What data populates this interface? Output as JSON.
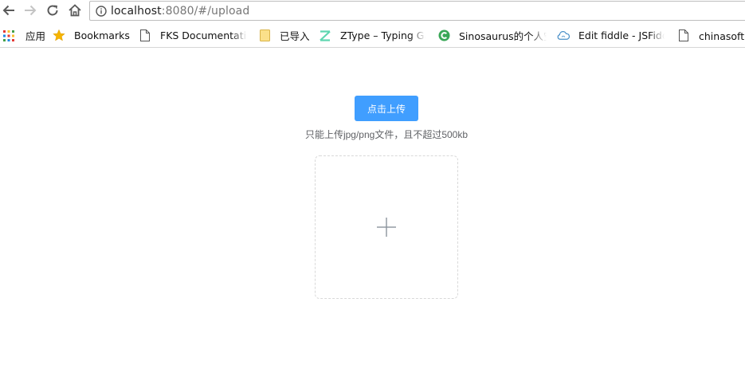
{
  "browser": {
    "url_host": "localhost",
    "url_rest": ":8080/#/upload"
  },
  "bookmarks": [
    {
      "label": "应用",
      "icon": "apps-grid-icon"
    },
    {
      "label": "Bookmarks",
      "icon": "star-icon"
    },
    {
      "label": "FKS Documentation",
      "icon": "page-icon"
    },
    {
      "label": "已导入",
      "icon": "folder-icon"
    },
    {
      "label": "ZType – Typing Game",
      "icon": "ztype-icon"
    },
    {
      "label": "Sinosaurus的个人空间",
      "icon": "sinosaurus-icon"
    },
    {
      "label": "Edit fiddle - JSFiddle",
      "icon": "cloud-icon"
    },
    {
      "label": "chinasoft内",
      "icon": "page-icon"
    }
  ],
  "upload": {
    "button_label": "点击上传",
    "tip": "只能上传jpg/png文件，且不超过500kb",
    "plus_icon": "plus-icon"
  },
  "colors": {
    "primary": "#409eff",
    "tip_text": "#606266",
    "border_dashed": "#d9d9d9",
    "plus": "#8c939d"
  }
}
